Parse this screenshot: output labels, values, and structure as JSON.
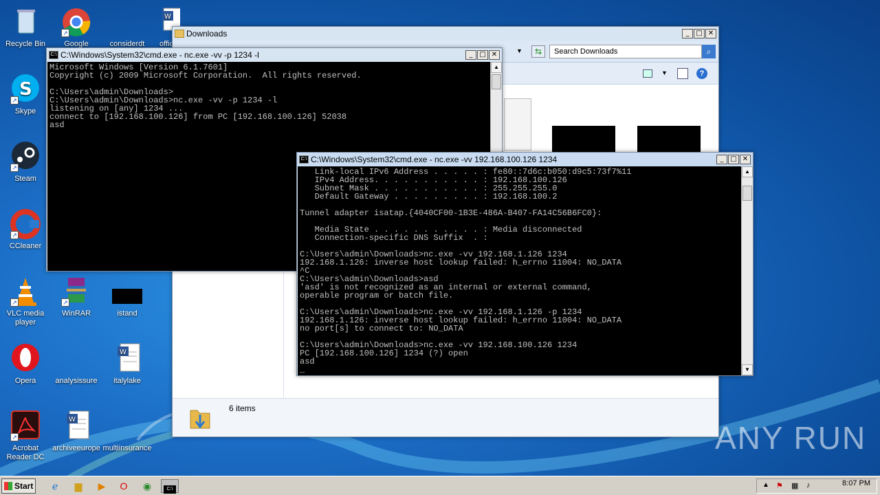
{
  "desktop": {
    "icons": [
      {
        "label": "Recycle Bin"
      },
      {
        "label": "Google"
      },
      {
        "label": "considerdt"
      },
      {
        "label": "offic"
      },
      {
        "label": "Skype"
      },
      {
        "label": "Steam"
      },
      {
        "label": "CCleaner"
      },
      {
        "label": "VLC media player"
      },
      {
        "label": "WinRAR"
      },
      {
        "label": "istand"
      },
      {
        "label": "Opera"
      },
      {
        "label": "analysissure"
      },
      {
        "label": "italylake"
      },
      {
        "label": "Acrobat Reader DC"
      },
      {
        "label": "archiveeurope"
      },
      {
        "label": "multiinsurance"
      }
    ]
  },
  "explorer": {
    "title": "Downloads",
    "search_placeholder": "Search Downloads",
    "status_items": "6 items"
  },
  "cmd1": {
    "title": "C:\\Windows\\System32\\cmd.exe - nc.exe  -vv -p 1234 -l",
    "lines": [
      "Microsoft Windows [Version 6.1.7601]",
      "Copyright (c) 2009 Microsoft Corporation.  All rights reserved.",
      "",
      "C:\\Users\\admin\\Downloads>",
      "C:\\Users\\admin\\Downloads>nc.exe -vv -p 1234 -l",
      "listening on [any] 1234 ...",
      "connect to [192.168.100.126] from PC [192.168.100.126] 52038",
      "asd"
    ]
  },
  "cmd2": {
    "title": "C:\\Windows\\System32\\cmd.exe - nc.exe  -vv 192.168.100.126 1234",
    "lines": [
      "   Link-local IPv6 Address . . . . . : fe80::7d6c:b050:d9c5:73f7%11",
      "   IPv4 Address. . . . . . . . . . . : 192.168.100.126",
      "   Subnet Mask . . . . . . . . . . . : 255.255.255.0",
      "   Default Gateway . . . . . . . . . : 192.168.100.2",
      "",
      "Tunnel adapter isatap.{4040CF00-1B3E-486A-B407-FA14C56B6FC0}:",
      "",
      "   Media State . . . . . . . . . . . : Media disconnected",
      "   Connection-specific DNS Suffix  . :",
      "",
      "C:\\Users\\admin\\Downloads>nc.exe -vv 192.168.1.126 1234",
      "192.168.1.126: inverse host lookup failed: h_errno 11004: NO_DATA",
      "^C",
      "C:\\Users\\admin\\Downloads>asd",
      "'asd' is not recognized as an internal or external command,",
      "operable program or batch file.",
      "",
      "C:\\Users\\admin\\Downloads>nc.exe -vv 192.168.1.126 -p 1234",
      "192.168.1.126: inverse host lookup failed: h_errno 11004: NO_DATA",
      "no port[s] to connect to: NO_DATA",
      "",
      "C:\\Users\\admin\\Downloads>nc.exe -vv 192.168.100.126 1234",
      "PC [192.168.100.126] 1234 (?) open",
      "asd",
      "_"
    ]
  },
  "taskbar": {
    "start_label": "Start",
    "clock": "8:07 PM"
  },
  "watermark": "ANY RUN"
}
